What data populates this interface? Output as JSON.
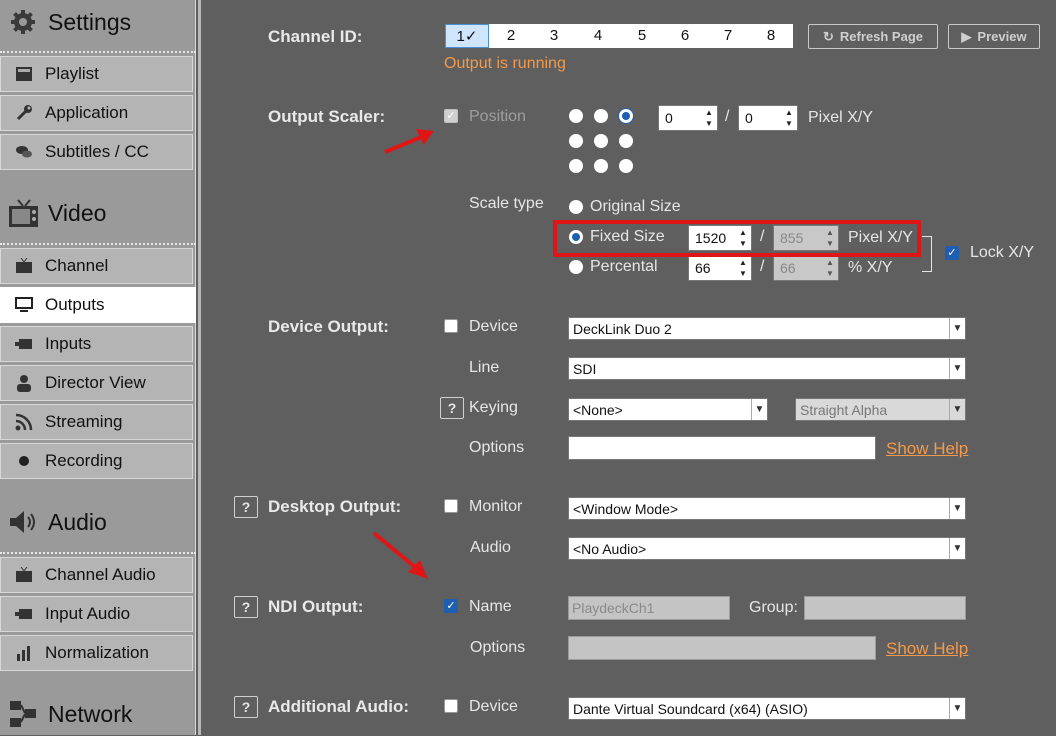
{
  "sidebar": {
    "sections": [
      {
        "label": "Settings",
        "icon": "gear-icon"
      },
      {
        "label": "Video",
        "icon": "tv-icon"
      },
      {
        "label": "Audio",
        "icon": "speaker-icon"
      },
      {
        "label": "Network",
        "icon": "network-icon"
      }
    ],
    "items": [
      {
        "label": "Playlist",
        "icon": "playlist-icon"
      },
      {
        "label": "Application",
        "icon": "wrench-icon"
      },
      {
        "label": "Subtitles / CC",
        "icon": "speech-bubbles-icon"
      },
      {
        "label": "Channel",
        "icon": "tv-small-icon"
      },
      {
        "label": "Outputs",
        "icon": "monitor-icon"
      },
      {
        "label": "Inputs",
        "icon": "input-icon"
      },
      {
        "label": "Director View",
        "icon": "person-icon"
      },
      {
        "label": "Streaming",
        "icon": "rss-icon"
      },
      {
        "label": "Recording",
        "icon": "record-dot-icon"
      },
      {
        "label": "Channel Audio",
        "icon": "tv-small-icon"
      },
      {
        "label": "Input Audio",
        "icon": "input-icon"
      },
      {
        "label": "Normalization",
        "icon": "bars-icon"
      }
    ]
  },
  "channel": {
    "label": "Channel ID:",
    "tabs": [
      "1✓",
      "2",
      "3",
      "4",
      "5",
      "6",
      "7",
      "8"
    ],
    "status": "Output is running",
    "refresh_label": "Refresh Page",
    "preview_label": "Preview"
  },
  "scaler": {
    "label": "Output Scaler:",
    "position_label": "Position",
    "x_value": "0",
    "y_value": "0",
    "pixel_xy": "Pixel X/Y",
    "scale_type_label": "Scale type",
    "original_size": "Original Size",
    "fixed_size": "Fixed Size",
    "fixed_w": "1520",
    "fixed_h": "855",
    "percental": "Percental",
    "pct_w": "66",
    "pct_h": "66",
    "pct_xy": "% X/Y",
    "lock_label": "Lock X/Y",
    "slash": "/"
  },
  "device_output": {
    "label": "Device Output:",
    "device_label": "Device",
    "device_value": "DeckLink Duo 2",
    "line_label": "Line",
    "line_value": "SDI",
    "keying_label": "Keying",
    "keying_value": "<None>",
    "alpha_value": "Straight Alpha",
    "options_label": "Options",
    "options_value": "",
    "show_help": "Show Help"
  },
  "desktop_output": {
    "label": "Desktop Output:",
    "monitor_label": "Monitor",
    "monitor_value": "<Window Mode>",
    "audio_label": "Audio",
    "audio_value": "<No Audio>"
  },
  "ndi_output": {
    "label": "NDI Output:",
    "name_label": "Name",
    "name_value": "PlaydeckCh1",
    "group_label": "Group:",
    "group_value": "",
    "options_label": "Options",
    "options_value": "",
    "show_help": "Show Help"
  },
  "additional_audio": {
    "label": "Additional Audio:",
    "device_label": "Device",
    "device_value": "Dante Virtual Soundcard (x64) (ASIO)"
  },
  "help_mark": "?",
  "colors": {
    "accent": "#1e5fb0",
    "warning": "#f2994a",
    "highlight": "#e01515"
  }
}
